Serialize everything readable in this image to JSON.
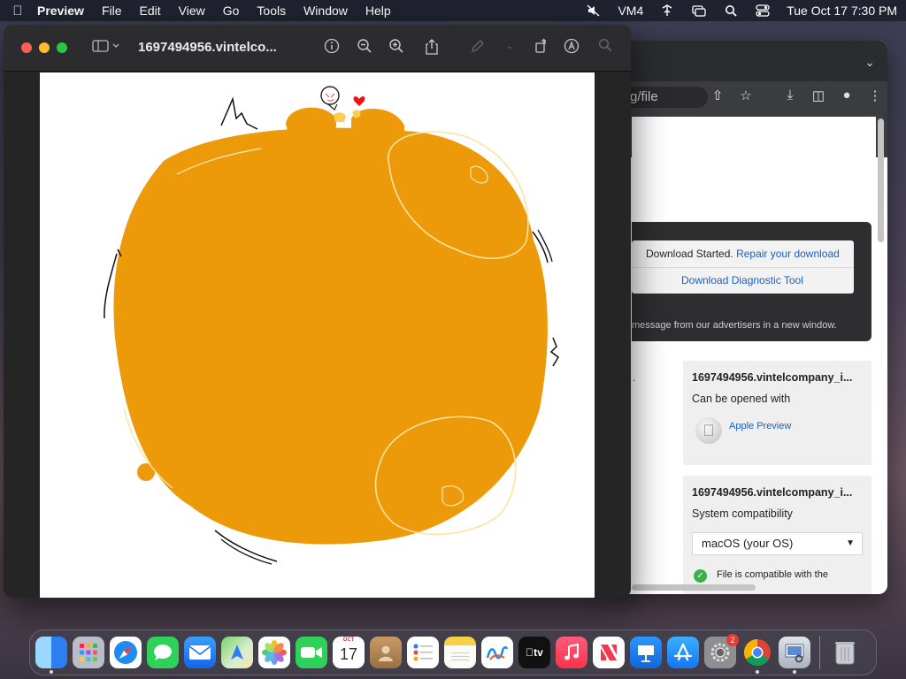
{
  "menubar": {
    "app_name": "Preview",
    "menus": [
      "File",
      "Edit",
      "View",
      "Go",
      "Tools",
      "Window",
      "Help"
    ],
    "vpn_label": "VM4",
    "datetime": "Tue Oct 17  7:30 PM"
  },
  "preview": {
    "document_title": "1697494956.vintelco...",
    "icons": [
      "sidebar-icon",
      "info-icon",
      "zoom-out-icon",
      "zoom-in-icon",
      "share-icon",
      "markup-icon",
      "rotate-icon",
      "annotate-icon",
      "search-icon"
    ]
  },
  "browser": {
    "url_fragment": "g/file",
    "download_started": "Download Started.",
    "repair_link": "Repair your download",
    "diagnostic_link": "Download Diagnostic Tool",
    "ad_message": "message from our advertisers in a new window.",
    "stray_text": ".",
    "card1": {
      "filename": "1697494956.vintelcompany_i...",
      "subtitle": "Can be opened with",
      "app_name": "Apple Preview"
    },
    "card2": {
      "filename": "1697494956.vintelcompany_i...",
      "subtitle": "System compatibility",
      "selected_os": "macOS (your OS)",
      "compat_text": "File is compatible with the"
    }
  },
  "dock": {
    "calendar_month": "OCT",
    "calendar_day": "17",
    "tv_label": "tv",
    "settings_badge": "2",
    "apps": [
      "Finder",
      "Launchpad",
      "Safari",
      "Messages",
      "Mail",
      "Maps",
      "Photos",
      "FaceTime",
      "Calendar",
      "Contacts",
      "Reminders",
      "Notes",
      "Freeform",
      "TV",
      "Music",
      "News",
      "Keynote",
      "App Store",
      "System Settings",
      "Chrome",
      "Preview",
      "Trash"
    ]
  },
  "colors": {
    "art_fill": "#ec9a0a",
    "art_line": "#ffe2a0"
  }
}
